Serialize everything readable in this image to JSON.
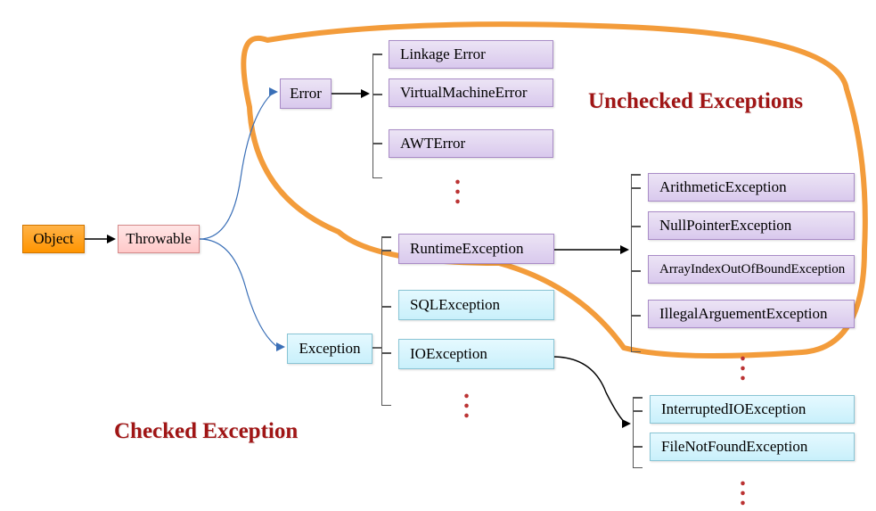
{
  "nodes": {
    "object": "Object",
    "throwable": "Throwable",
    "error": "Error",
    "exception": "Exception",
    "linkage_error": "Linkage Error",
    "vm_error": "VirtualMachineError",
    "awt_error": "AWTError",
    "runtime_exception": "RuntimeException",
    "sql_exception": "SQLException",
    "io_exception": "IOException",
    "arithmetic": "ArithmeticException",
    "npe": "NullPointerException",
    "aioobe": "ArrayIndexOutOfBoundException",
    "illegal_arg": "IllegalArguementException",
    "interrupted_io": "InterruptedIOException",
    "fnf": "FileNotFoundException"
  },
  "labels": {
    "unchecked": "Unchecked Exceptions",
    "checked": "Checked Exception"
  }
}
